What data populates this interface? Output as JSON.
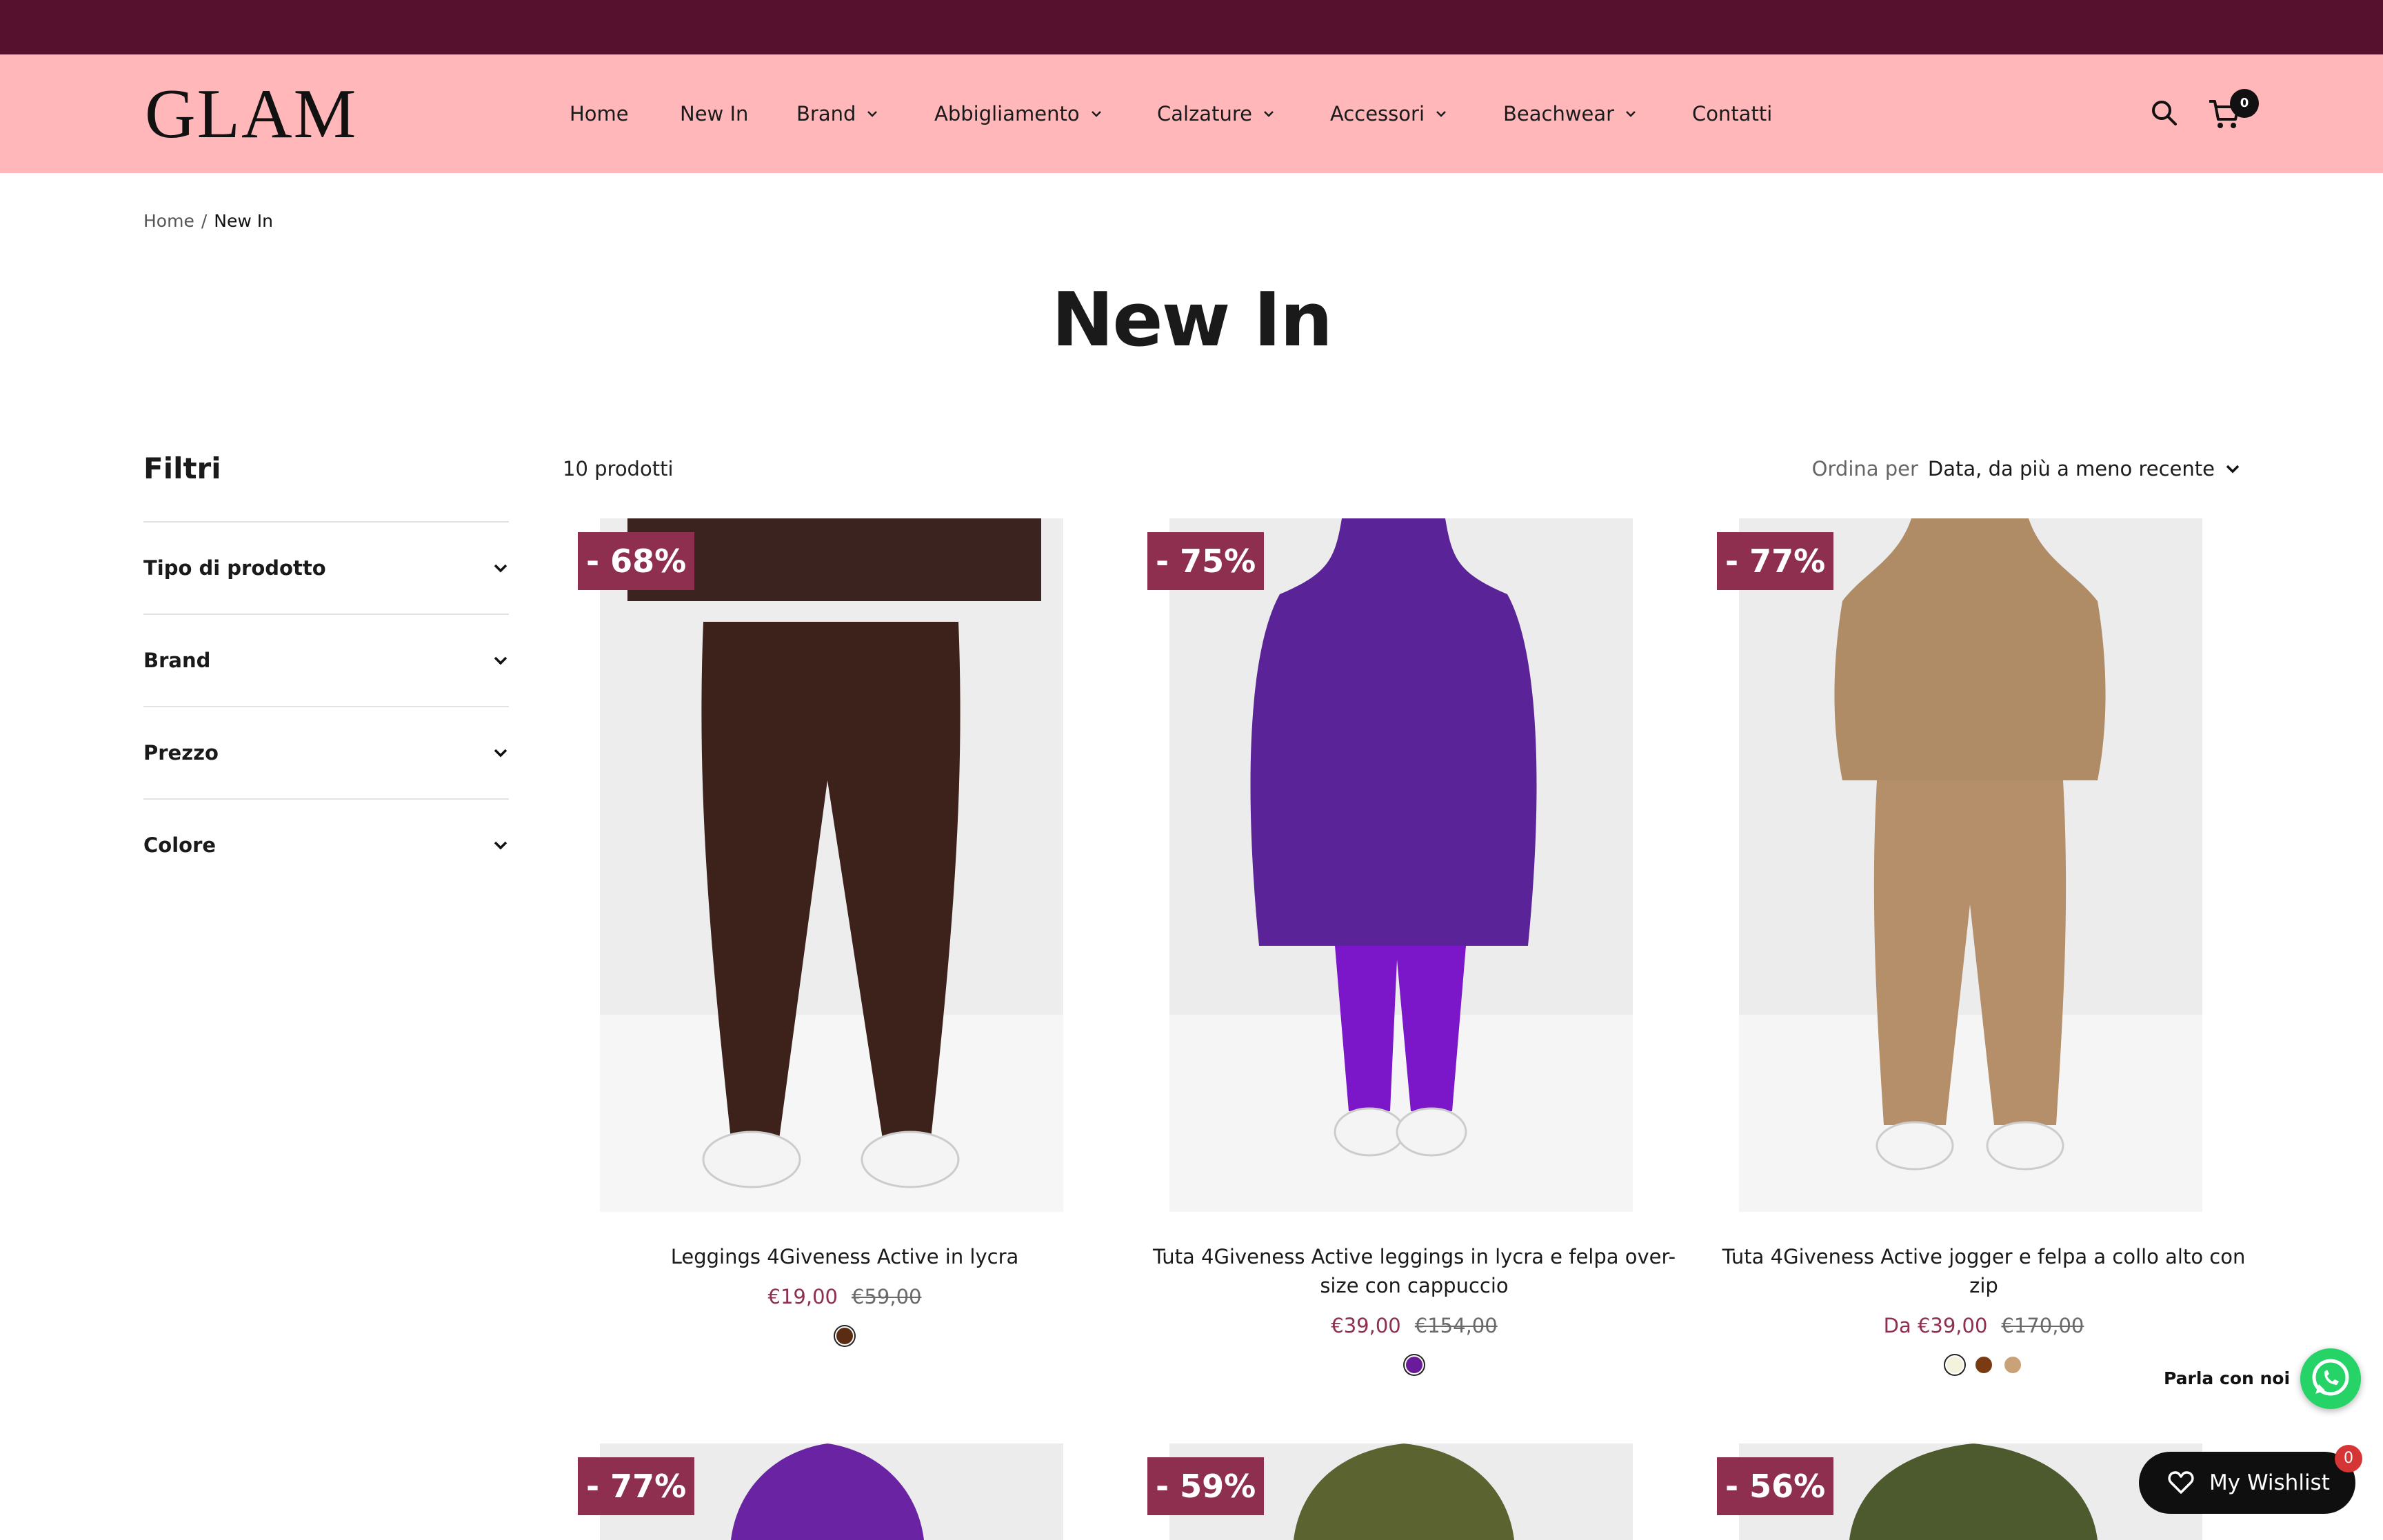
{
  "header": {
    "logo": "GLAM",
    "nav": [
      {
        "label": "Home",
        "has_dropdown": false
      },
      {
        "label": "New In",
        "has_dropdown": false
      },
      {
        "label": "Brand",
        "has_dropdown": true
      },
      {
        "label": "Abbigliamento",
        "has_dropdown": true
      },
      {
        "label": "Calzature",
        "has_dropdown": true
      },
      {
        "label": "Accessori",
        "has_dropdown": true
      },
      {
        "label": "Beachwear",
        "has_dropdown": true
      },
      {
        "label": "Contatti",
        "has_dropdown": false
      }
    ],
    "search_icon": "search-icon",
    "cart_icon": "cart-icon",
    "cart_count": "0"
  },
  "breadcrumb": {
    "home": "Home",
    "separator": "/",
    "current": "New In"
  },
  "page": {
    "title": "New In"
  },
  "filters": {
    "title": "Filtri",
    "items": [
      {
        "label": "Tipo di prodotto"
      },
      {
        "label": "Brand"
      },
      {
        "label": "Prezzo"
      },
      {
        "label": "Colore"
      }
    ]
  },
  "toolbar": {
    "count": "10 prodotti",
    "sort_prefix": "Ordina per",
    "sort_value": "Data, da più a meno recente"
  },
  "products": [
    {
      "badge": "- 68%",
      "name": "Leggings 4Giveness Active in lycra",
      "price": "€19,00",
      "compare": "€59,00",
      "swatches": [
        "#5a2d12"
      ],
      "image": "leggings"
    },
    {
      "badge": "- 75%",
      "name": "Tuta 4Giveness Active leggings in lycra e felpa over-size con cappuccio",
      "price": "€39,00",
      "compare": "€154,00",
      "swatches": [
        "#6a1b9a"
      ],
      "image": "hoodie"
    },
    {
      "badge": "- 77%",
      "name": "Tuta 4Giveness Active jogger e felpa a collo alto con zip",
      "price": "Da €39,00",
      "compare": "€170,00",
      "swatches": [
        "#f4f2dc",
        "#7a3a12",
        "#c9a27a"
      ],
      "image": "jogger"
    },
    {
      "badge": "- 77%",
      "image": "purple"
    },
    {
      "badge": "- 59%",
      "image": "olive"
    },
    {
      "badge": "- 56%",
      "image": "olive2"
    }
  ],
  "chat": {
    "label": "Parla con noi",
    "icon": "whatsapp-icon"
  },
  "wishlist": {
    "label": "My Wishlist",
    "count": "0",
    "icon": "heart-icon"
  },
  "colors": {
    "announcement": "#55112d",
    "header": "#ffb7ba",
    "badge": "#8f2f4f",
    "price": "#8f2f4f"
  }
}
